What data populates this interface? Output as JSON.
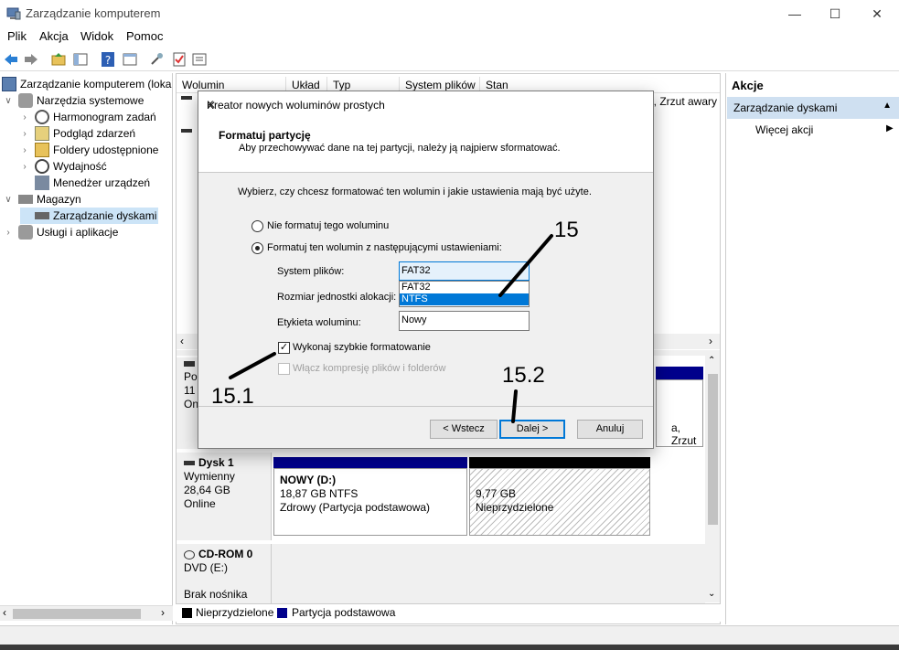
{
  "window": {
    "title": "Zarządzanie komputerem"
  },
  "menu": [
    "Plik",
    "Akcja",
    "Widok",
    "Pomoc"
  ],
  "tree": {
    "root": "Zarządzanie komputerem (loka",
    "system_tools": "Narzędzia systemowe",
    "scheduler": "Harmonogram zadań",
    "event_viewer": "Podgląd zdarzeń",
    "shared_folders": "Foldery udostępnione",
    "performance": "Wydajność",
    "device_manager": "Menedżer urządzeń",
    "storage": "Magazyn",
    "disk_mgmt": "Zarządzanie dyskami",
    "services": "Usługi i aplikacje"
  },
  "volume_list": {
    "columns": [
      "Wolumin",
      "Układ",
      "Typ",
      "System plików",
      "Stan"
    ],
    "right_snippet": "a, Zrzut awary"
  },
  "disks": {
    "disk0_label": [
      "Po",
      "11",
      "On"
    ],
    "disk0_snippet": "a, Zrzut",
    "disk1": {
      "name": "Dysk 1",
      "type": "Wymienny",
      "size": "28,64 GB",
      "status": "Online"
    },
    "partition_main": {
      "name": "NOWY  (D:)",
      "size": "18,87 GB NTFS",
      "status": "Zdrowy (Partycja podstawowa)"
    },
    "partition_free": {
      "size": "9,77 GB",
      "status": "Nieprzydzielone"
    },
    "cdrom": {
      "name": "CD-ROM 0",
      "drive": "DVD (E:)",
      "status": "Brak nośnika"
    }
  },
  "legend": {
    "unallocated": "Nieprzydzielone",
    "primary": "Partycja podstawowa"
  },
  "actions": {
    "header": "Akcje",
    "section": "Zarządzanie dyskami",
    "more": "Więcej akcji"
  },
  "dialog": {
    "title": "Kreator nowych woluminów prostych",
    "heading": "Formatuj partycję",
    "subheading": "Aby przechowywać dane na tej partycji, należy ją najpierw sformatować.",
    "instruction": "Wybierz, czy chcesz formatować ten wolumin i jakie ustawienia mają być użyte.",
    "radio_no_format": "Nie formatuj tego woluminu",
    "radio_format": "Formatuj ten wolumin z następującymi ustawieniami:",
    "fs_label": "System plików:",
    "fs_value": "FAT32",
    "fs_options": [
      "FAT32",
      "NTFS"
    ],
    "fs_selected_option": "NTFS",
    "alloc_label": "Rozmiar jednostki alokacji:",
    "vol_label_label": "Etykieta woluminu:",
    "vol_label_value": "Nowy",
    "quick_format": "Wykonaj szybkie formatowanie",
    "compression": "Włącz kompresję plików i folderów",
    "btn_back": "< Wstecz",
    "btn_next": "Dalej >",
    "btn_cancel": "Anuluj"
  },
  "annotations": {
    "a1": "15",
    "a2": "15.1",
    "a3": "15.2"
  },
  "colors": {
    "primary_partition": "#00008b",
    "unallocated": "#000000",
    "selection": "#0078d7",
    "actions_section": "#cfe0f1"
  }
}
